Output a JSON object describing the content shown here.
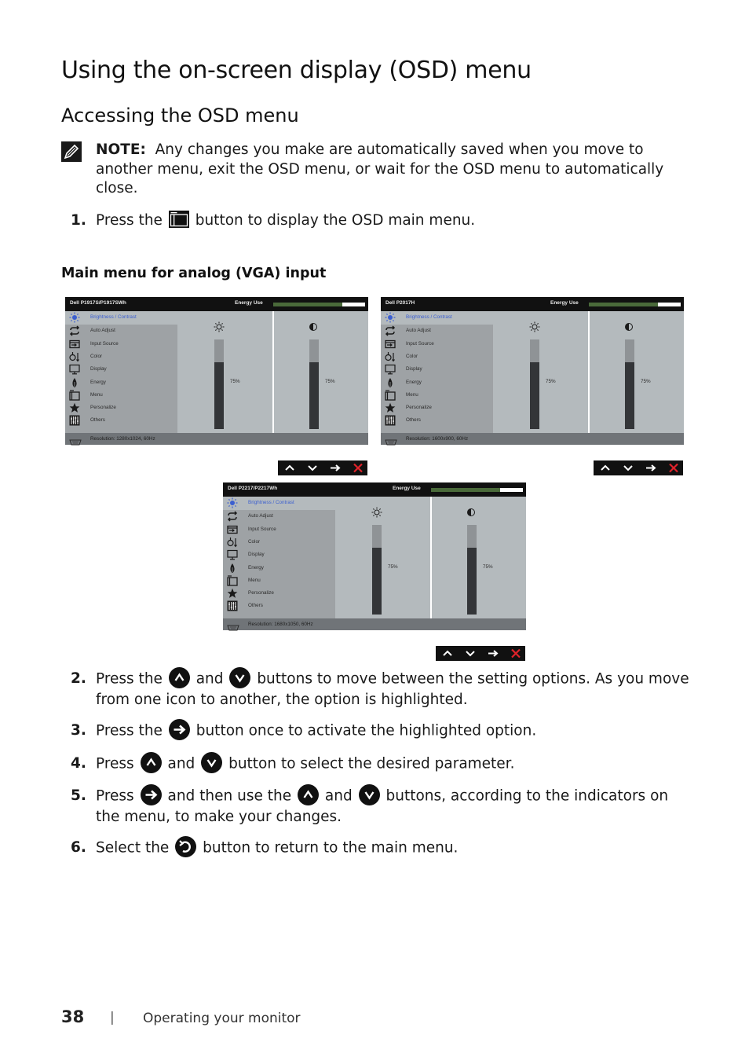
{
  "page": {
    "title": "Using the on-screen display (OSD) menu",
    "section": "Accessing the OSD menu",
    "note": {
      "label": "NOTE:",
      "text": "Any changes you make are automatically saved when you move to another menu, exit the OSD menu, or wait for the OSD menu to automatically close."
    },
    "step1": {
      "num": "1.",
      "pre": "Press the",
      "post": "button to display the OSD main menu."
    },
    "subheading": "Main menu for analog (VGA) input",
    "steps": [
      {
        "num": "2.",
        "a": "Press the",
        "b": "and",
        "c": "buttons to move between the setting options. As you move from one icon to another, the option is highlighted."
      },
      {
        "num": "3.",
        "a": "Press the",
        "b": "button once to activate the highlighted option."
      },
      {
        "num": "4.",
        "a": "Press",
        "b": "and",
        "c": "button to select the desired parameter."
      },
      {
        "num": "5.",
        "a": "Press",
        "b": "and then use the",
        "c": "and",
        "d": "buttons, according to the indicators on the menu, to make your changes."
      },
      {
        "num": "6.",
        "a": "Select the",
        "b": "button to return to the main menu."
      }
    ],
    "footer": {
      "page_number": "38",
      "separator": "|",
      "chapter": "Operating your monitor"
    }
  },
  "osd_common": {
    "energy_label": "Energy Use",
    "energy_level": 0.75,
    "menu_items": [
      {
        "label": "Brightness / Contrast",
        "icon": "brightness-icon",
        "selected": true
      },
      {
        "label": "Auto Adjust",
        "icon": "auto-adjust-icon"
      },
      {
        "label": "Input Source",
        "icon": "input-source-icon"
      },
      {
        "label": "Color",
        "icon": "color-icon"
      },
      {
        "label": "Display",
        "icon": "display-icon"
      },
      {
        "label": "Energy",
        "icon": "energy-icon"
      },
      {
        "label": "Menu",
        "icon": "menu-icon"
      },
      {
        "label": "Personalize",
        "icon": "personalize-icon"
      },
      {
        "label": "Others",
        "icon": "others-icon"
      }
    ],
    "brightness_value": "75%",
    "contrast_value": "75%",
    "brightness_level": 0.75,
    "contrast_level": 0.75,
    "buttons": [
      "up-icon",
      "down-icon",
      "enter-icon",
      "exit-icon"
    ],
    "exit_color": "#e0222a"
  },
  "osds": [
    {
      "model": "Dell P1917S/P1917SWh",
      "resolution": "Resolution: 1280x1024, 60Hz"
    },
    {
      "model": "Dell P2017H",
      "resolution": "Resolution: 1600x900, 60Hz"
    },
    {
      "model": "Dell P2217/P2217Wh",
      "resolution": "Resolution: 1680x1050, 60Hz"
    }
  ]
}
